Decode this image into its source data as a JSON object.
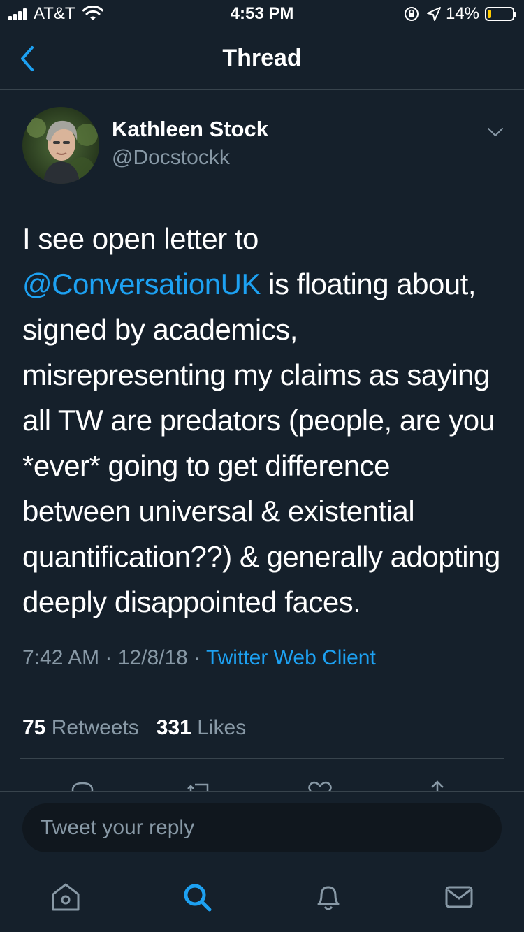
{
  "status_bar": {
    "carrier": "AT&T",
    "time": "4:53 PM",
    "battery_percent": "14%",
    "battery_level": 0.14,
    "battery_color": "#ffcc00"
  },
  "nav": {
    "title": "Thread",
    "back_icon": "chevron-left-icon"
  },
  "tweet": {
    "author_name": "Kathleen Stock",
    "author_handle": "@Docstockk",
    "text_before_mention": "I see open letter to",
    "mention": "@ConversationUK",
    "text_after_mention": " is floating about, signed by academics, misrepresenting my claims as saying all TW are predators (people, are you *ever* going to get difference between universal & existential quantification??) & generally adopting deeply disappointed faces.",
    "time": "7:42 AM",
    "date": "12/8/18",
    "separator": " · ",
    "client": "Twitter Web Client",
    "retweet_count": "75",
    "retweet_label": "Retweets",
    "like_count": "331",
    "like_label": "Likes"
  },
  "reply": {
    "placeholder": "Tweet your reply"
  },
  "tab_bar": {
    "items": [
      "home-icon",
      "search-icon",
      "notifications-icon",
      "messages-icon"
    ],
    "active_color": "#1da1f2",
    "inactive_color": "#8899a6"
  },
  "colors": {
    "background": "#15202b",
    "accent": "#1da1f2",
    "secondary_text": "#8899a6",
    "divider": "#38444d"
  }
}
